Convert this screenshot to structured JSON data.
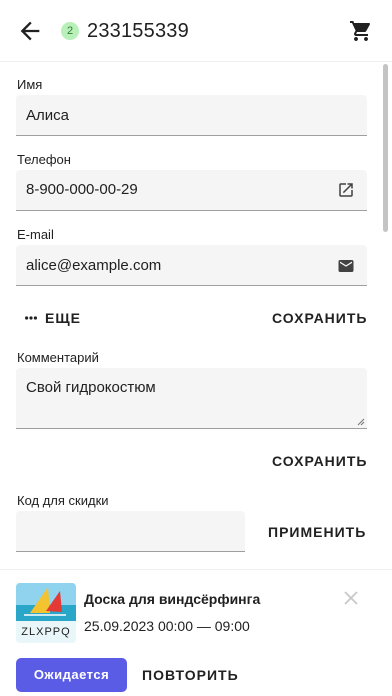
{
  "header": {
    "badge": "2",
    "order_number": "233155339"
  },
  "form": {
    "name_label": "Имя",
    "name_value": "Алиса",
    "phone_label": "Телефон",
    "phone_value": "8-900-000-00-29",
    "email_label": "E-mail",
    "email_value": "alice@example.com",
    "more_label": "ЕЩЕ",
    "save_label": "СОХРАНИТЬ",
    "comment_label": "Комментарий",
    "comment_value": "Свой гидрокостюм",
    "save2_label": "СОХРАНИТЬ",
    "discount_label": "Код для скидки",
    "discount_value": "",
    "apply_label": "ПРИМЕНИТЬ"
  },
  "item": {
    "title": "Доска для виндсёрфинга",
    "dates": "25.09.2023 00:00 — 09:00",
    "code": "ZLXPPQ"
  },
  "actions": {
    "status": "Ожидается",
    "repeat": "ПОВТОРИТЬ"
  },
  "icons": {
    "back": "arrow-left-icon",
    "cart": "cart-icon",
    "phone_action": "external-link-icon",
    "email_action": "mail-icon",
    "more": "more-dots-icon",
    "close": "close-icon"
  },
  "colors": {
    "accent": "#5b5ce6",
    "badge_bg": "#b9f0b9"
  }
}
